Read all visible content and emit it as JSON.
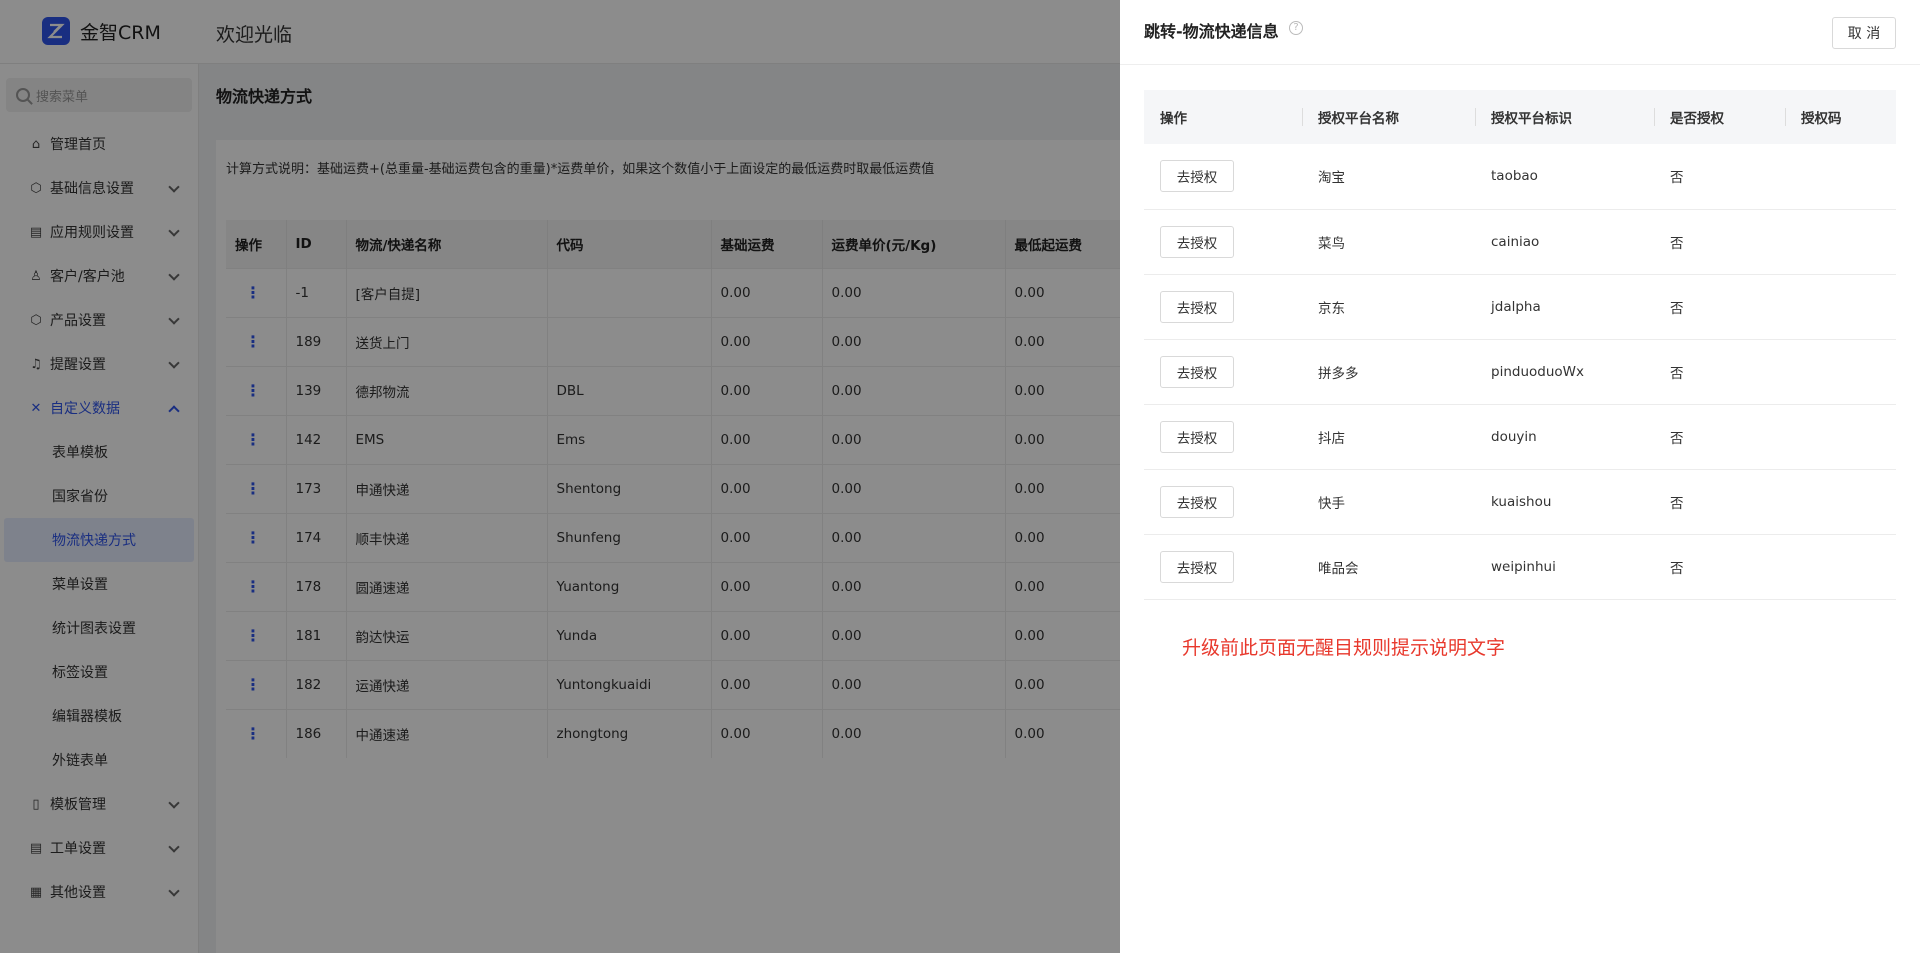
{
  "header": {
    "brand": "金智CRM",
    "welcome": "欢迎光临"
  },
  "sidebar": {
    "search_placeholder": "搜索菜单",
    "items": [
      {
        "label": "管理首页",
        "icon": "home-icon"
      },
      {
        "label": "基础信息设置",
        "icon": "cube-icon"
      },
      {
        "label": "应用规则设置",
        "icon": "document-icon"
      },
      {
        "label": "客户/客户池",
        "icon": "user-icon"
      },
      {
        "label": "产品设置",
        "icon": "cube-icon"
      },
      {
        "label": "提醒设置",
        "icon": "bell-icon"
      },
      {
        "label": "自定义数据",
        "icon": "tools-icon"
      }
    ],
    "sub_items": [
      "表单模板",
      "国家省份",
      "物流快递方式",
      "菜单设置",
      "统计图表设置",
      "标签设置",
      "编辑器模板",
      "外链表单"
    ],
    "bottom_items": [
      {
        "label": "模板管理",
        "icon": "template-icon"
      },
      {
        "label": "工单设置",
        "icon": "ticket-icon"
      },
      {
        "label": "其他设置",
        "icon": "grid-icon"
      }
    ]
  },
  "main": {
    "title": "物流快递方式",
    "calc_note": "计算方式说明：基础运费+(总重量-基础运费包含的重量)*运费单价，如果这个数值小于上面设定的最低运费时取最低运费值",
    "columns": [
      "操作",
      "ID",
      "物流/快递名称",
      "代码",
      "基础运费",
      "运费单价(元/Kg)",
      "最低起运费"
    ],
    "rows": [
      [
        "-1",
        "[客户自提]",
        "",
        "0.00",
        "0.00",
        "0.00"
      ],
      [
        "189",
        "送货上门",
        "",
        "0.00",
        "0.00",
        "0.00"
      ],
      [
        "139",
        "德邦物流",
        "DBL",
        "0.00",
        "0.00",
        "0.00"
      ],
      [
        "142",
        "EMS",
        "Ems",
        "0.00",
        "0.00",
        "0.00"
      ],
      [
        "173",
        "申通快递",
        "Shentong",
        "0.00",
        "0.00",
        "0.00"
      ],
      [
        "174",
        "顺丰快递",
        "Shunfeng",
        "0.00",
        "0.00",
        "0.00"
      ],
      [
        "178",
        "圆通速递",
        "Yuantong",
        "0.00",
        "0.00",
        "0.00"
      ],
      [
        "181",
        "韵达快运",
        "Yunda",
        "0.00",
        "0.00",
        "0.00"
      ],
      [
        "182",
        "运通快递",
        "Yuntongkuaidi",
        "0.00",
        "0.00",
        "0.00"
      ],
      [
        "186",
        "中通速递",
        "zhongtong",
        "0.00",
        "0.00",
        "0.00"
      ]
    ]
  },
  "drawer": {
    "title": "跳转-物流快递信息",
    "help": "?",
    "cancel": "取 消",
    "columns": [
      "操作",
      "授权平台名称",
      "授权平台标识",
      "是否授权",
      "授权码"
    ],
    "auth_button": "去授权",
    "rows": [
      [
        "淘宝",
        "taobao",
        "否",
        ""
      ],
      [
        "菜鸟",
        "cainiao",
        "否",
        ""
      ],
      [
        "京东",
        "jdalpha",
        "否",
        ""
      ],
      [
        "拼多多",
        "pinduoduoWx",
        "否",
        ""
      ],
      [
        "抖店",
        "douyin",
        "否",
        ""
      ],
      [
        "快手",
        "kuaishou",
        "否",
        ""
      ],
      [
        "唯品会",
        "weipinhui",
        "否",
        ""
      ]
    ],
    "note": "升级前此页面无醒目规则提示说明文字"
  },
  "colors": {
    "accent": "#2f54eb",
    "note_red": "#e8382c"
  }
}
